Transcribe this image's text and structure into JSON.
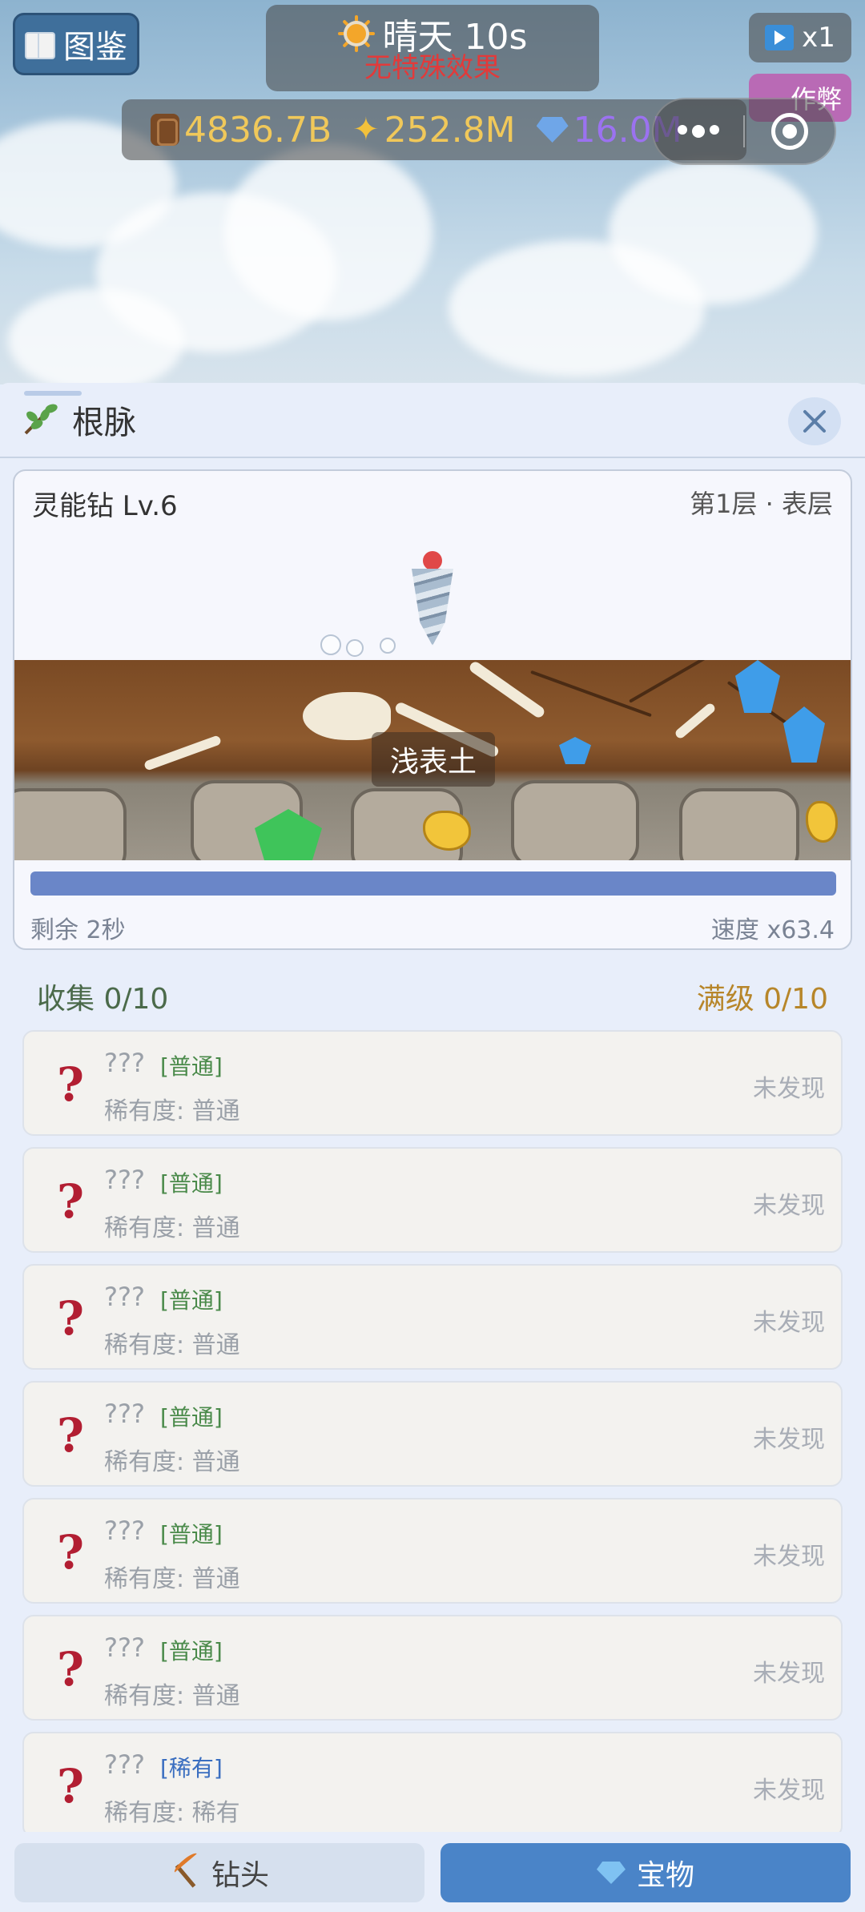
{
  "top": {
    "atlas_button": "图鉴",
    "weather_title": "晴天 10s",
    "weather_effect": "无特殊效果",
    "speed_button": "x1",
    "cheat_button": "作弊",
    "resources": {
      "wood": "4836.7B",
      "spark": "252.8M",
      "gem": "16.0M"
    }
  },
  "panel": {
    "title": "根脉",
    "drill": {
      "name": "灵能钻 Lv.6",
      "layer": "第1层 · 表层",
      "depth_label": "浅表土",
      "progress": 1.0,
      "remaining": "剩余 2秒",
      "speed": "速度 x63.4"
    },
    "collection": {
      "label": "收集 0/10",
      "max_label": "满级 0/10"
    },
    "items": [
      {
        "name": "???",
        "tag": "[普通]",
        "rarity": "稀有度: 普通",
        "status": "未发现",
        "tier": "common"
      },
      {
        "name": "???",
        "tag": "[普通]",
        "rarity": "稀有度: 普通",
        "status": "未发现",
        "tier": "common"
      },
      {
        "name": "???",
        "tag": "[普通]",
        "rarity": "稀有度: 普通",
        "status": "未发现",
        "tier": "common"
      },
      {
        "name": "???",
        "tag": "[普通]",
        "rarity": "稀有度: 普通",
        "status": "未发现",
        "tier": "common"
      },
      {
        "name": "???",
        "tag": "[普通]",
        "rarity": "稀有度: 普通",
        "status": "未发现",
        "tier": "common"
      },
      {
        "name": "???",
        "tag": "[普通]",
        "rarity": "稀有度: 普通",
        "status": "未发现",
        "tier": "common"
      },
      {
        "name": "???",
        "tag": "[稀有]",
        "rarity": "稀有度: 稀有",
        "status": "未发现",
        "tier": "rare"
      }
    ]
  },
  "tabs": {
    "drill": "钻头",
    "treasure": "宝物"
  },
  "colors": {
    "accent": "#4a84c8",
    "unknown_icon": "#b21e32",
    "common_tag": "#4a8a4a",
    "rare_tag": "#3a6ec0"
  }
}
